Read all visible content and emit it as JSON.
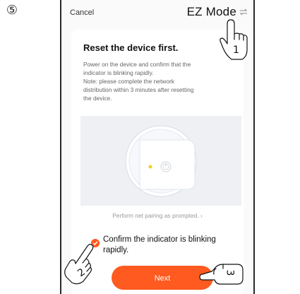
{
  "step_marker": "⑤",
  "nav": {
    "cancel_label": "Cancel",
    "mode_label": "EZ Mode"
  },
  "card": {
    "title": "Reset the device first.",
    "instructions": [
      "Power on the device and confirm that the",
      "indicator is blinking rapidly.",
      "Note: please complete the network",
      "distribution within 3 minutes after resetting",
      "the device."
    ],
    "pairing_link": "Perform net pairing as prompted. ›",
    "confirm": {
      "text": "Confirm the indicator is blinking rapidly.",
      "checked": true
    },
    "next_label": "Next"
  },
  "annotations": {
    "hand_1_label": "1",
    "hand_2_label": "2",
    "hand_3_label": "3"
  },
  "colors": {
    "accent": "#ff5a1f",
    "indicator": "#f5d020",
    "illustration_bg": "#eef0f4"
  }
}
